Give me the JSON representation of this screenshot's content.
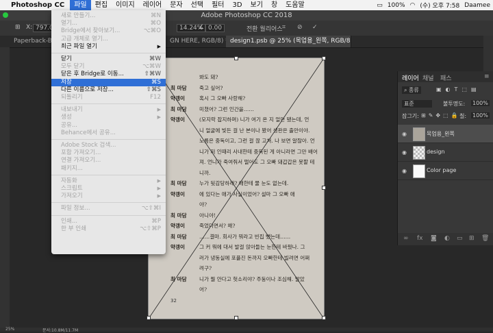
{
  "menubar": {
    "app": "Photoshop CC",
    "items": [
      "파일",
      "편집",
      "이미지",
      "레이어",
      "문자",
      "선택",
      "필터",
      "3D",
      "보기",
      "창",
      "도움말"
    ],
    "clock": "(수) 오후 7:58",
    "user": "Daamee",
    "battery": "100%"
  },
  "window_title": "Adobe Photoshop CC 2018",
  "options": {
    "x_label": "X:",
    "x_value": "797.00 p",
    "scale": "14.24%",
    "rotate": "0.00",
    "interp": "전환 월리어스"
  },
  "tabs": [
    {
      "label": "Paperback-Book-",
      "active": false
    },
    {
      "label": "GN HERE, RGB/8) *",
      "active": false
    },
    {
      "label": "design1.psb @ 25% (목업용_왼쪽, RGB/8)",
      "active": true
    }
  ],
  "file_menu": [
    {
      "label": "새로 만들기...",
      "sc": "⌘N",
      "dis": true
    },
    {
      "label": "열기...",
      "sc": "⌘O",
      "dis": true
    },
    {
      "label": "Bridge에서 찾아보기...",
      "sc": "⌥⌘O",
      "dis": true
    },
    {
      "label": "고급 개체로 열기...",
      "sc": "",
      "dis": true
    },
    {
      "label": "최근 파일 열기",
      "sc": "",
      "dis": false,
      "arrow": true
    },
    {
      "sep": true
    },
    {
      "label": "닫기",
      "sc": "⌘W",
      "dis": false
    },
    {
      "label": "모두 닫기",
      "sc": "⌥⌘W",
      "dis": true
    },
    {
      "label": "닫은 후 Bridge로 이동...",
      "sc": "⇧⌘W",
      "dis": false
    },
    {
      "label": "저장",
      "sc": "⌘S",
      "dis": false,
      "sel": true
    },
    {
      "label": "다른 이름으로 저장...",
      "sc": "⇧⌘S",
      "dis": false
    },
    {
      "label": "되돌리기",
      "sc": "F12",
      "dis": true
    },
    {
      "sep": true
    },
    {
      "label": "내보내기",
      "sc": "",
      "dis": true,
      "arrow": true
    },
    {
      "label": "생성",
      "sc": "",
      "dis": true,
      "arrow": true
    },
    {
      "label": "공유...",
      "sc": "",
      "dis": true
    },
    {
      "label": "Behance에서 공유...",
      "sc": "",
      "dis": true
    },
    {
      "sep": true
    },
    {
      "label": "Adobe Stock 검색...",
      "sc": "",
      "dis": true
    },
    {
      "label": "포함 가져오기...",
      "sc": "",
      "dis": true
    },
    {
      "label": "연결 가져오기...",
      "sc": "",
      "dis": true
    },
    {
      "label": "패키지...",
      "sc": "",
      "dis": true
    },
    {
      "sep": true
    },
    {
      "label": "자동화",
      "sc": "",
      "dis": true,
      "arrow": true
    },
    {
      "label": "스크립트",
      "sc": "",
      "dis": true,
      "arrow": true
    },
    {
      "label": "가져오기",
      "sc": "",
      "dis": true,
      "arrow": true
    },
    {
      "sep": true
    },
    {
      "label": "파일 정보...",
      "sc": "⌥⇧⌘I",
      "dis": true
    },
    {
      "sep": true
    },
    {
      "label": "인쇄...",
      "sc": "⌘P",
      "dis": true
    },
    {
      "label": "한 부 인쇄",
      "sc": "⌥⇧⌘P",
      "dis": true
    }
  ],
  "doc_lines": [
    {
      "spk": "",
      "text": "봐도 돼?"
    },
    {
      "spk": "최 마담",
      "text": "죽고 싶어?"
    },
    {
      "spk": "약갱이",
      "text": "혹시 그 오빠 사랑해?"
    },
    {
      "spk": "최 마담",
      "text": "미쳤어? 그런 인간을……"
    },
    {
      "spk": "약갱이",
      "text": "(모지락 잡지하며) 니가 여기 온 지 얼만 됐는데, 언"
    },
    {
      "spk": "",
      "text": "니 얼굴에 빛든 걸 난 본이나 봤어 생판은 출만이야."
    },
    {
      "spk": "",
      "text": "노름은 중독이고, 그런 걸 끊 고쳐. 나 보면 알잖아. 언"
    },
    {
      "spk": "",
      "text": "니가 저 인때리 사내한테 중독된 게 아니라면 그만 배어"
    },
    {
      "spk": "",
      "text": "져. 언니가 죽여줘서 떨어도 그 오빠 돼갑갑은 못할 테"
    },
    {
      "spk": "",
      "text": "니까."
    },
    {
      "spk": "최 마담",
      "text": "누가 뒷감당하래? 애한테 물 눈도 없는데."
    },
    {
      "spk": "약갱이",
      "text": "에 있다는 애가 사실이었어? 설마 그 오빠 애"
    },
    {
      "spk": "",
      "text": "야?"
    },
    {
      "spk": "최 마담",
      "text": "아니야!"
    },
    {
      "spk": "약갱이",
      "text": "죽었다면서? 왜?"
    },
    {
      "spk": "최 마담",
      "text": "……결마. 회사가 뭐라고 빈집 뺐는데……"
    },
    {
      "spk": "약갱이",
      "text": "그 커 뭐에 대서 발걸 앉아들는 눈한테 바꿨나. 그"
    },
    {
      "spk": "",
      "text": "러가 냉동실에 포플진 돈까지 오빠한테 빌려면 어쩌"
    },
    {
      "spk": "",
      "text": "려구?"
    },
    {
      "spk": "최 마담",
      "text": "니가 뭘 안다고 헛소리야? 주둥이나 조심해. 알았"
    },
    {
      "spk": "",
      "text": "어?"
    }
  ],
  "page_number": "32",
  "layers_panel": {
    "tabs": [
      "레이어",
      "채널",
      "패스"
    ],
    "kind": "종류",
    "blend": "표준",
    "opacity_label": "불투명도:",
    "opacity": "100%",
    "lock_label": "잠그기:",
    "fill_label": "칠:",
    "fill": "100%",
    "layers": [
      {
        "name": "목업용_왼쪽",
        "active": true
      },
      {
        "name": "design",
        "active": false
      },
      {
        "name": "Color page",
        "active": false
      }
    ]
  },
  "status": {
    "zoom": "25%",
    "doc": "문서:10.8M/11.7M"
  },
  "colors": {
    "menu_select": "#2f6fd6",
    "app_bg": "#282828"
  }
}
